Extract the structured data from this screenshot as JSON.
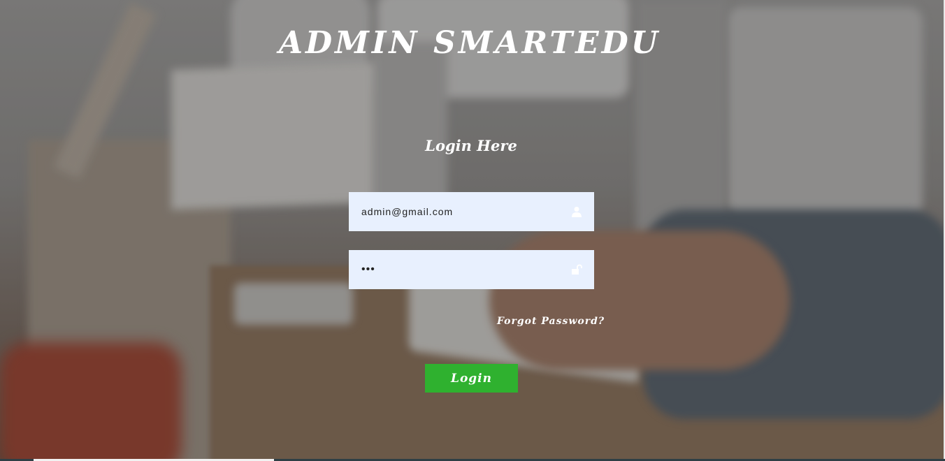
{
  "app": {
    "title": "ADMIN SMARTEDU"
  },
  "login_form": {
    "heading": "Login Here",
    "email": {
      "value": "admin@gmail.com",
      "icon": "user-icon"
    },
    "password": {
      "value": "abc",
      "icon": "unlock-icon"
    },
    "forgot_password_label": "Forgot Password?",
    "submit_label": "Login"
  },
  "colors": {
    "input_background": "#e8f0fe",
    "login_button": "#2fb12f",
    "text": "#ffffff"
  }
}
